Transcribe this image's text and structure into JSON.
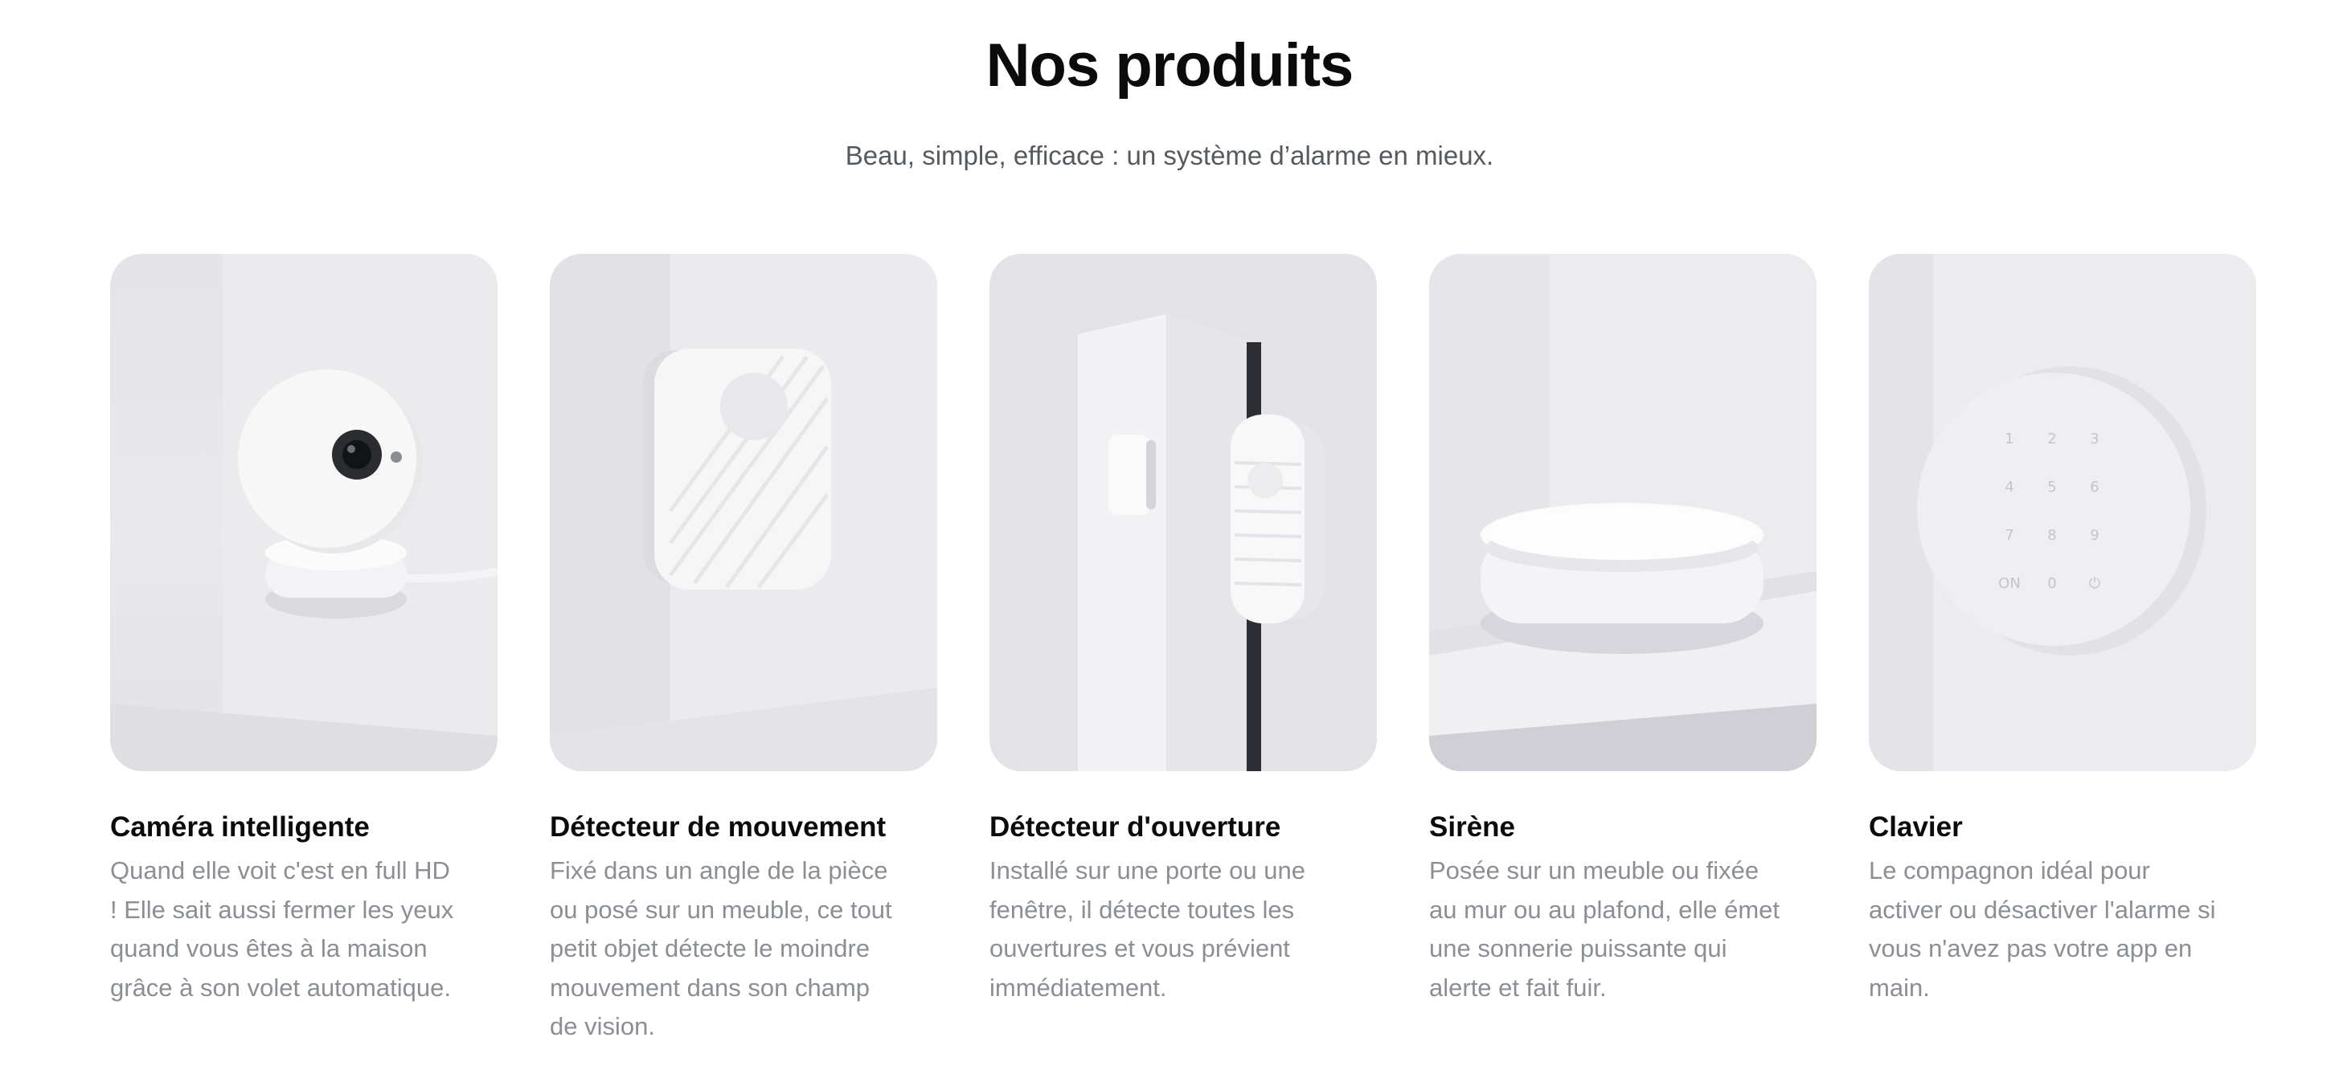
{
  "header": {
    "title": "Nos produits",
    "subtitle": "Beau, simple, efficace : un système d’alarme en mieux."
  },
  "products": [
    {
      "title": "Caméra intelligente",
      "description": "Quand elle voit c'est en full HD ! Elle sait aussi fermer les yeux quand vous êtes à la maison grâce à son volet automatique.",
      "image_icon": "camera-icon"
    },
    {
      "title": "Détecteur de mouvement",
      "description": "Fixé dans un angle de la pièce ou posé sur un meuble, ce tout petit objet détecte le moindre mouvement dans son champ de vision.",
      "image_icon": "motion-detector-icon"
    },
    {
      "title": "Détecteur d'ouverture",
      "description": "Installé sur une porte ou une fenêtre, il détecte toutes les ouvertures et vous prévient immédiatement.",
      "image_icon": "door-sensor-icon"
    },
    {
      "title": "Sirène",
      "description": "Posée sur un meuble ou fixée au mur ou au plafond, elle émet une sonnerie puissante qui alerte et fait fuir.",
      "image_icon": "siren-icon"
    },
    {
      "title": "Clavier",
      "description": "Le compagnon idéal pour activer ou désactiver l'alarme si vous n'avez pas votre app en main.",
      "image_icon": "keypad-icon",
      "keypad_keys": [
        "1",
        "2",
        "3",
        "4",
        "5",
        "6",
        "7",
        "8",
        "9",
        "ON",
        "0",
        "⏻"
      ]
    }
  ],
  "colors": {
    "title": "#0b0b0b",
    "subtitle": "#555a5f",
    "card_background": "#e6e6ea",
    "description": "#8b8f94"
  }
}
